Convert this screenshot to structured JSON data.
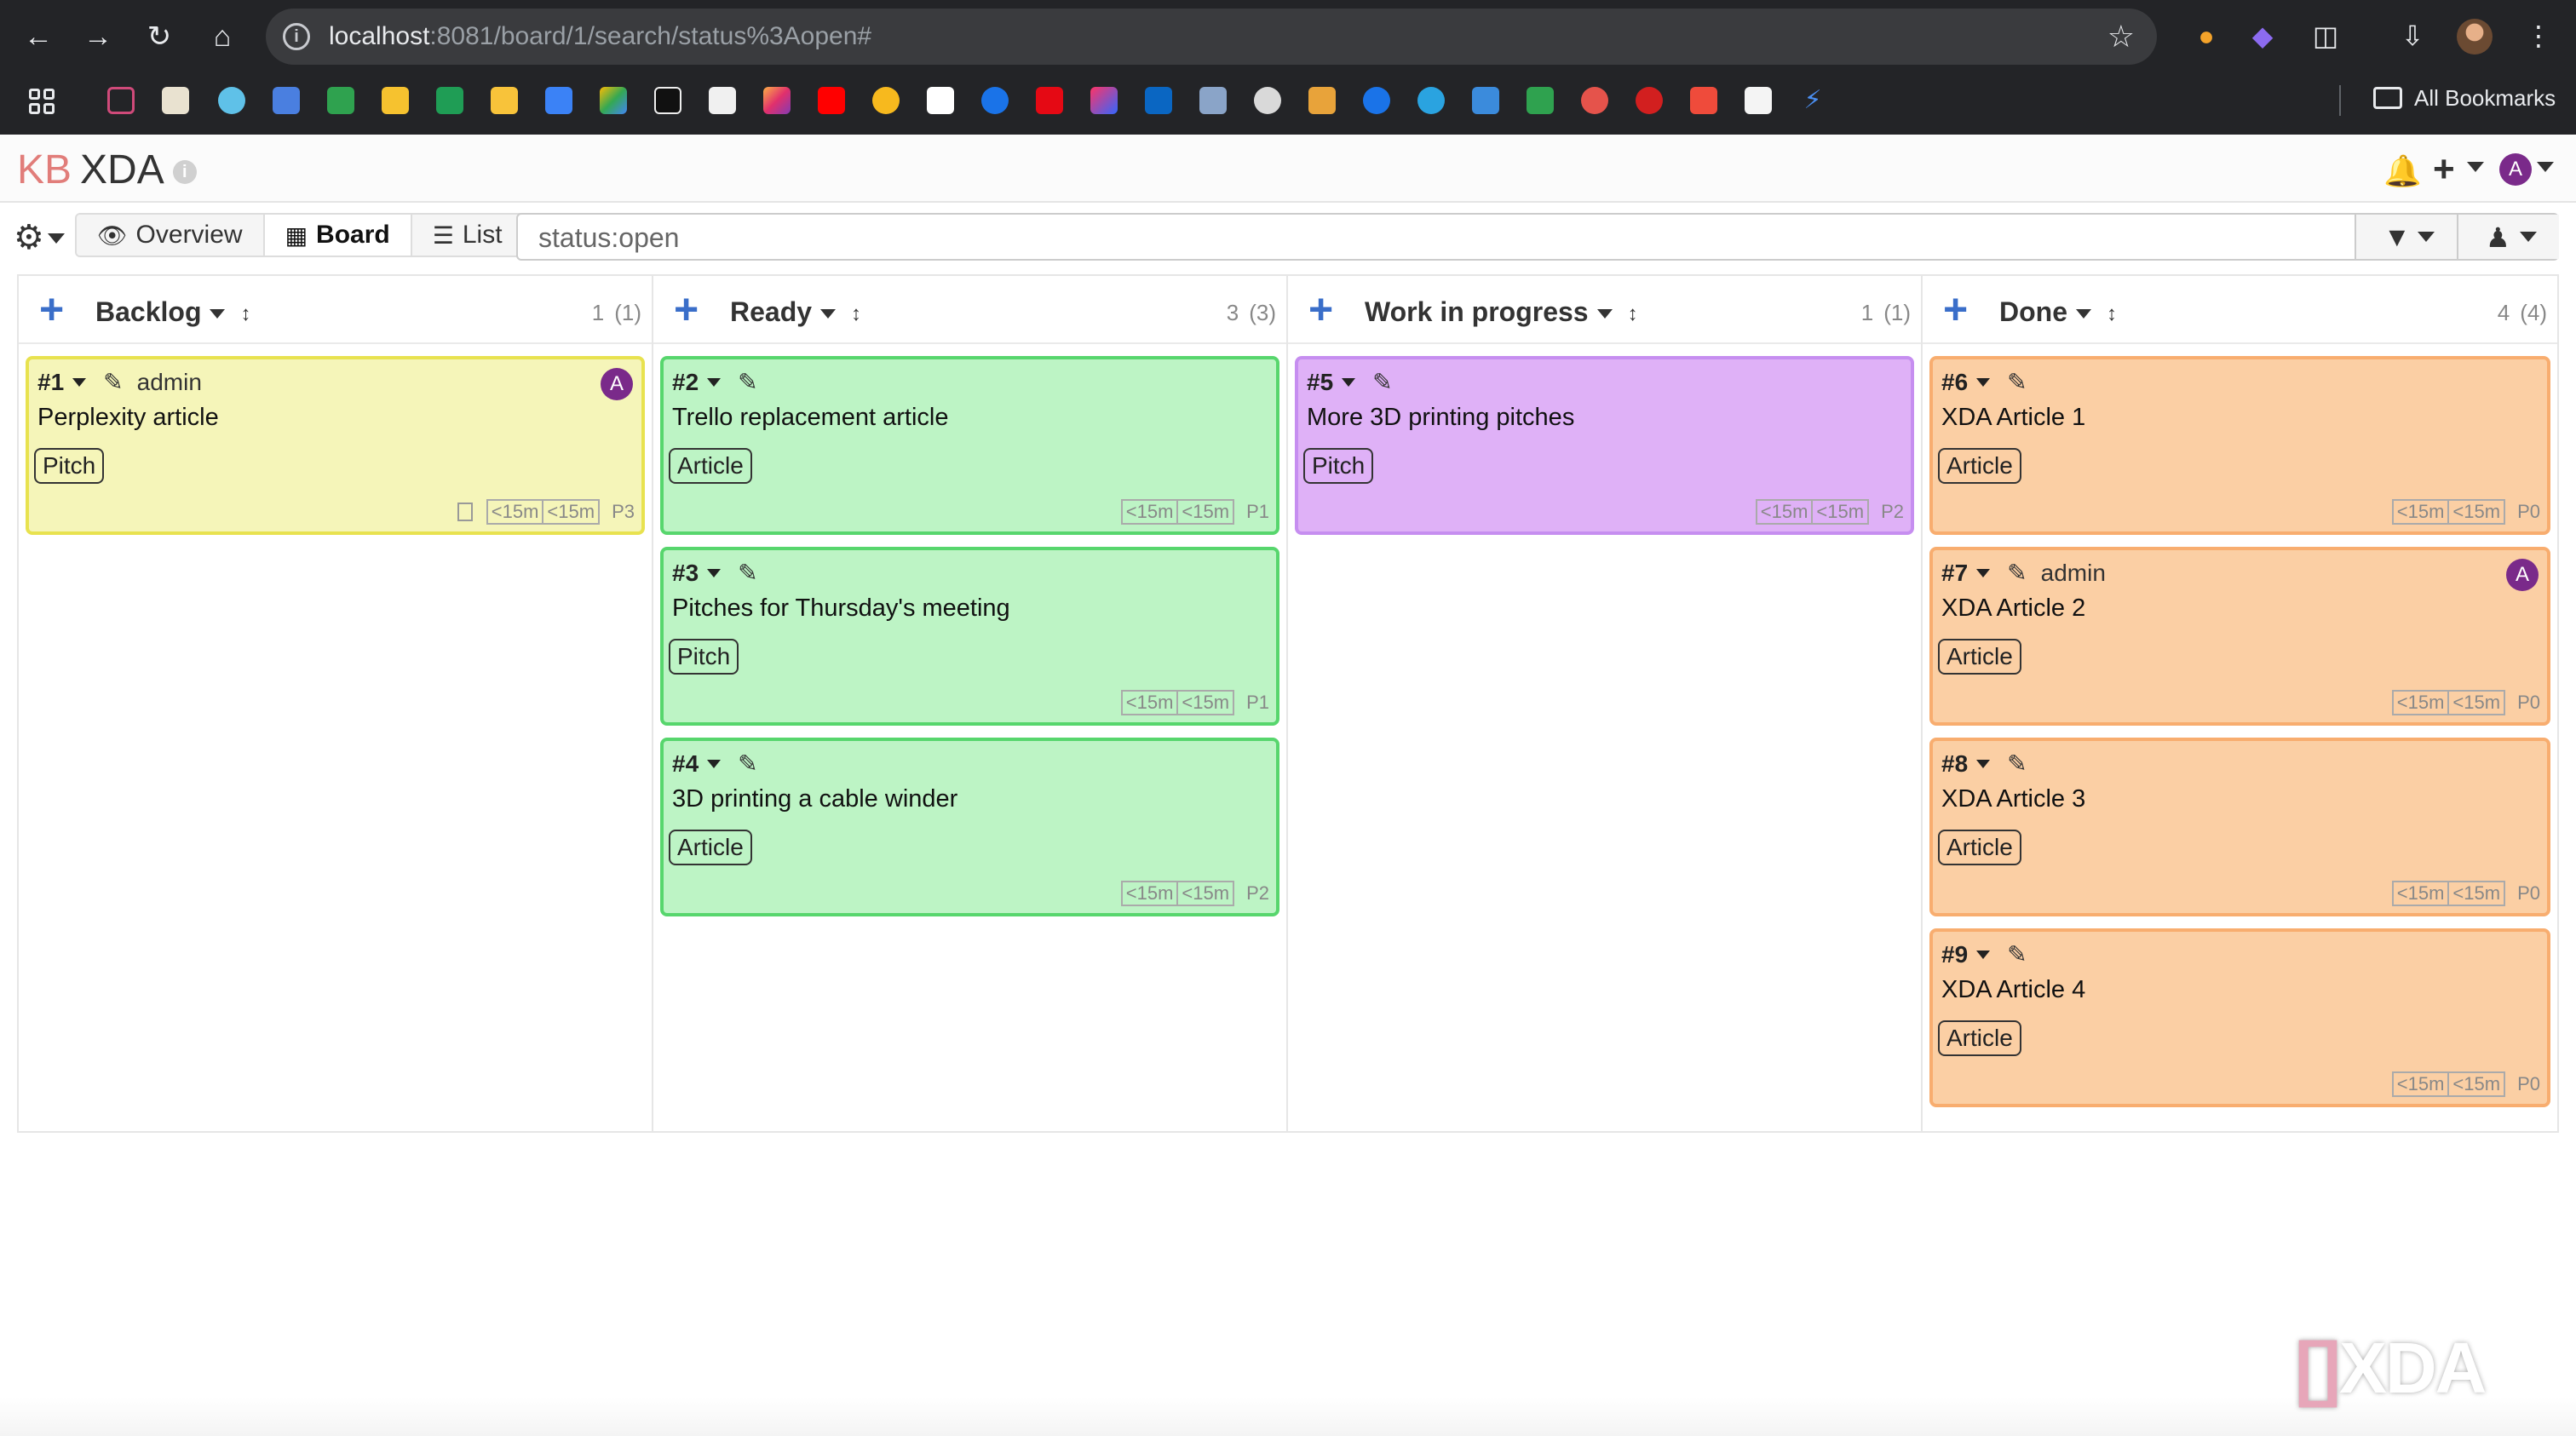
{
  "browser": {
    "url_host": "localhost",
    "url_rest": ":8081/board/1/search/status%3Aopen#",
    "all_bookmarks": "All Bookmarks"
  },
  "header": {
    "logo_kb": "KB",
    "project": "XDA",
    "user_initial": "A"
  },
  "toolbar": {
    "views": [
      {
        "label": "Overview",
        "icon": "eye-icon"
      },
      {
        "label": "Board",
        "icon": "grid-icon"
      },
      {
        "label": "List",
        "icon": "list-icon"
      }
    ],
    "search_value": "status:open"
  },
  "columns": [
    {
      "title": "Backlog",
      "count": "1",
      "count_total": "(1)"
    },
    {
      "title": "Ready",
      "count": "3",
      "count_total": "(3)"
    },
    {
      "title": "Work in progress",
      "count": "1",
      "count_total": "(1)"
    },
    {
      "title": "Done",
      "count": "4",
      "count_total": "(4)"
    }
  ],
  "cards": [
    {
      "id": "#1",
      "owner": "admin",
      "avatar": "A",
      "title": "Perplexity article",
      "tag": "Pitch",
      "t1": "<15m",
      "t2": "<15m",
      "priority": "P3",
      "color": "yellow"
    },
    {
      "id": "#2",
      "title": "Trello replacement article",
      "tag": "Article",
      "t1": "<15m",
      "t2": "<15m",
      "priority": "P1",
      "color": "green"
    },
    {
      "id": "#3",
      "title": "Pitches for Thursday's meeting",
      "tag": "Pitch",
      "t1": "<15m",
      "t2": "<15m",
      "priority": "P1",
      "color": "green"
    },
    {
      "id": "#4",
      "title": "3D printing a cable winder",
      "tag": "Article",
      "t1": "<15m",
      "t2": "<15m",
      "priority": "P2",
      "color": "green"
    },
    {
      "id": "#5",
      "title": "More 3D printing pitches",
      "tag": "Pitch",
      "t1": "<15m",
      "t2": "<15m",
      "priority": "P2",
      "color": "purple"
    },
    {
      "id": "#6",
      "title": "XDA Article 1",
      "tag": "Article",
      "t1": "<15m",
      "t2": "<15m",
      "priority": "P0",
      "color": "orange"
    },
    {
      "id": "#7",
      "owner": "admin",
      "avatar": "A",
      "title": "XDA Article 2",
      "tag": "Article",
      "t1": "<15m",
      "t2": "<15m",
      "priority": "P0",
      "color": "orange"
    },
    {
      "id": "#8",
      "title": "XDA Article 3",
      "tag": "Article",
      "t1": "<15m",
      "t2": "<15m",
      "priority": "P0",
      "color": "orange"
    },
    {
      "id": "#9",
      "title": "XDA Article 4",
      "tag": "Article",
      "t1": "<15m",
      "t2": "<15m",
      "priority": "P0",
      "color": "orange"
    }
  ],
  "watermark": {
    "bracket": "[]",
    "text": "XDA"
  },
  "colors": {
    "yellow": "#f5f5b9",
    "green": "#bdf4c5",
    "purple": "#dfb1f7",
    "orange": "#fbcfa4",
    "accent_blue": "#3a6ec9",
    "avatar": "#7a2a8a"
  }
}
